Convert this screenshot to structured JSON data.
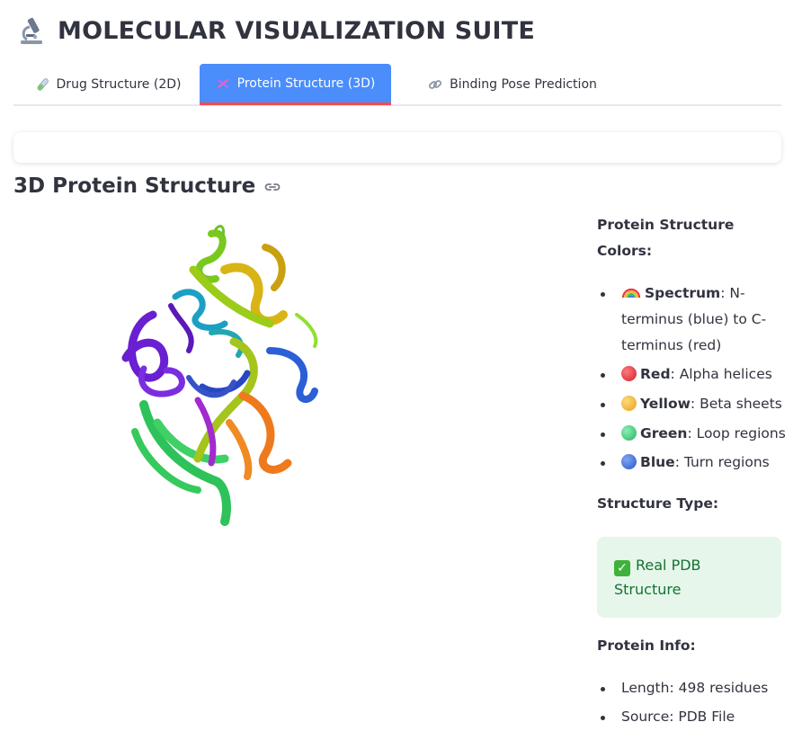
{
  "app": {
    "title": "MOLECULAR VISUALIZATION SUITE",
    "logo_icon": "microscope-icon"
  },
  "tabs": [
    {
      "label": "Drug Structure (2D)",
      "icon": "test-tube-icon",
      "active": false
    },
    {
      "label": "Protein Structure (3D)",
      "icon": "dna-icon",
      "active": true
    },
    {
      "label": "Binding Pose Prediction",
      "icon": "link-icon",
      "active": false
    }
  ],
  "section": {
    "title": "3D Protein Structure",
    "anchor_icon": "link-icon"
  },
  "legend": {
    "heading": "Protein Structure Colors:",
    "items": [
      {
        "icon": "rainbow-icon",
        "name": "Spectrum",
        "desc": ": N-terminus (blue) to C-terminus (red)"
      },
      {
        "icon": "red-circle-icon",
        "color": "#e8323c",
        "name": "Red",
        "desc": ": Alpha helices"
      },
      {
        "icon": "yellow-circle-icon",
        "color": "#f2b534",
        "name": "Yellow",
        "desc": ": Beta sheets"
      },
      {
        "icon": "green-circle-icon",
        "color": "#3cc97a",
        "name": "Green",
        "desc": ": Loop regions"
      },
      {
        "icon": "blue-circle-icon",
        "color": "#3a6fd8",
        "name": "Blue",
        "desc": ": Turn regions"
      }
    ]
  },
  "structure_type": {
    "heading": "Structure Type:",
    "status": "Real PDB Structure",
    "status_icon": "check-mark-icon"
  },
  "protein_info": {
    "heading": "Protein Info:",
    "items": [
      "Length: 498 residues",
      "Source: PDB File"
    ]
  },
  "colors": {
    "active_tab": "#4a8dfb",
    "tab_underline": "#ff4b4b",
    "success_bg": "#e6f6ea",
    "success_text": "#177233"
  }
}
